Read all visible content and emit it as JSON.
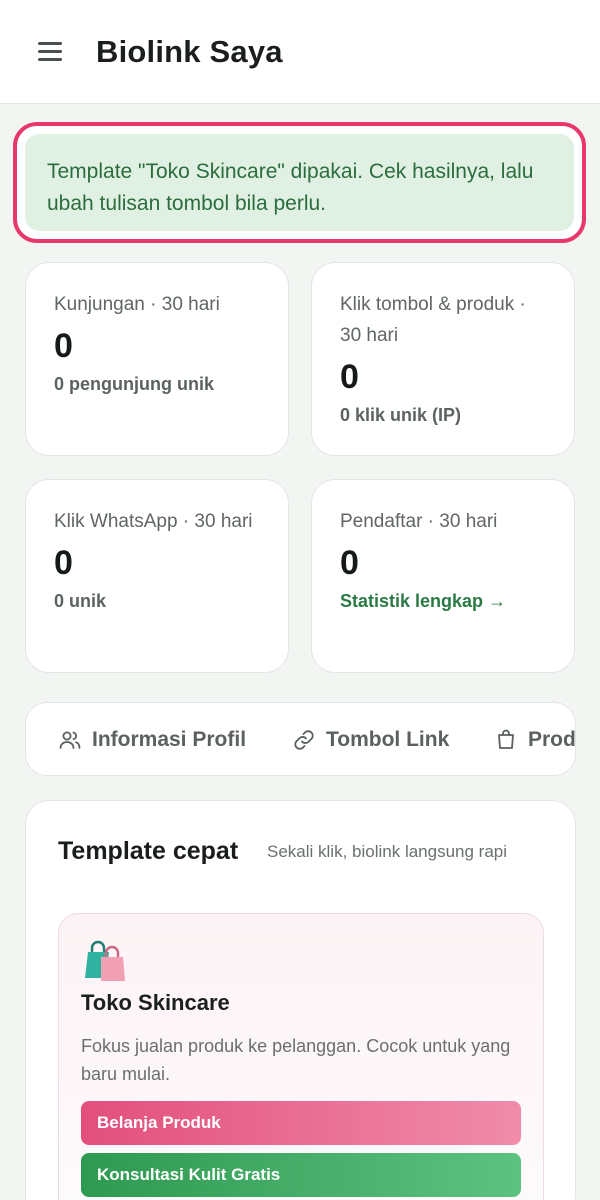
{
  "header": {
    "title": "Biolink Saya",
    "menu_icon": "hamburger-menu-icon"
  },
  "notice": {
    "text": "Template \"Toko Skincare\" dipakai. Cek hasilnya, lalu ubah tulisan tombol bila perlu.",
    "highlight_color": "#e8386b"
  },
  "stats": [
    {
      "label": "Kunjungan · 30 hari",
      "value": "0",
      "sub": "0 pengunjung unik"
    },
    {
      "label": "Klik tombol & produk · 30 hari",
      "value": "0",
      "sub": "0 klik unik (IP)"
    },
    {
      "label": "Klik WhatsApp · 30 hari",
      "value": "0",
      "sub": "0 unik"
    },
    {
      "label": "Pendaftar · 30 hari",
      "value": "0",
      "link": "Statistik lengkap →"
    }
  ],
  "tabs": [
    {
      "label": "Informasi Profil",
      "icon": "users-icon"
    },
    {
      "label": "Tombol Link",
      "icon": "link-icon"
    },
    {
      "label": "Prod",
      "icon": "shopping-bag-icon"
    }
  ],
  "templates": {
    "title": "Template cepat",
    "subtitle": "Sekali klik, biolink langsung rapi",
    "items": [
      {
        "icon": "shopping-bags-icon",
        "name": "Toko Skincare",
        "description": "Fokus jualan produk ke pelanggan. Cocok untuk yang baru mulai.",
        "buttons": [
          "Belanja Produk",
          "Konsultasi Kulit Gratis"
        ]
      }
    ]
  },
  "colors": {
    "accent_green": "#2b7a45",
    "notice_bg": "#e0f0e3",
    "pink_button": "#e24f7d",
    "green_button": "#2e9950"
  }
}
